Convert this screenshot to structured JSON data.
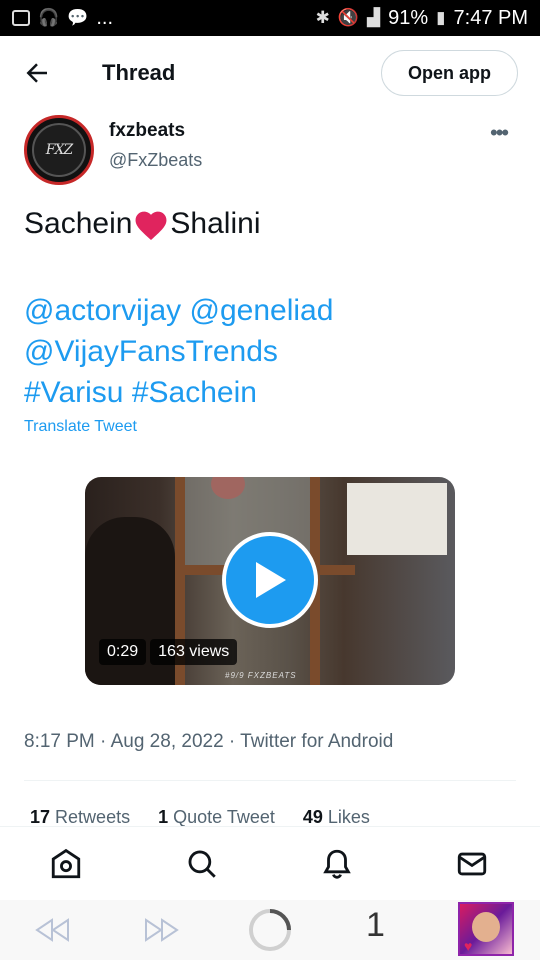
{
  "status_bar": {
    "battery": "91%",
    "time": "7:47 PM",
    "dots": "..."
  },
  "header": {
    "title": "Thread",
    "open_app_label": "Open app"
  },
  "author": {
    "name": "fxzbeats",
    "handle": "@FxZbeats",
    "avatar_text": "FXZ"
  },
  "tweet": {
    "text_before": "Sachein",
    "text_after": "Shalini",
    "mentions_line1": "@actorvijay @geneliad",
    "mentions_line2": "@VijayFansTrends",
    "hashtags_line": "#Varisu #Sachein",
    "translate_label": "Translate Tweet"
  },
  "video": {
    "duration": "0:29",
    "views": "163 views",
    "watermark": "#9/9 FXZBEATS"
  },
  "meta": {
    "line": "8:17 PM · Aug 28, 2022 · Twitter for Android"
  },
  "counts": {
    "retweets_count": "17",
    "retweets_label": "Retweets",
    "quotes_count": "1",
    "quotes_label": "Quote Tweet",
    "likes_count": "49",
    "likes_label": "Likes"
  },
  "browser": {
    "tab_count": "1"
  },
  "colors": {
    "accent": "#1d9bf0",
    "heart": "#e0245e"
  }
}
